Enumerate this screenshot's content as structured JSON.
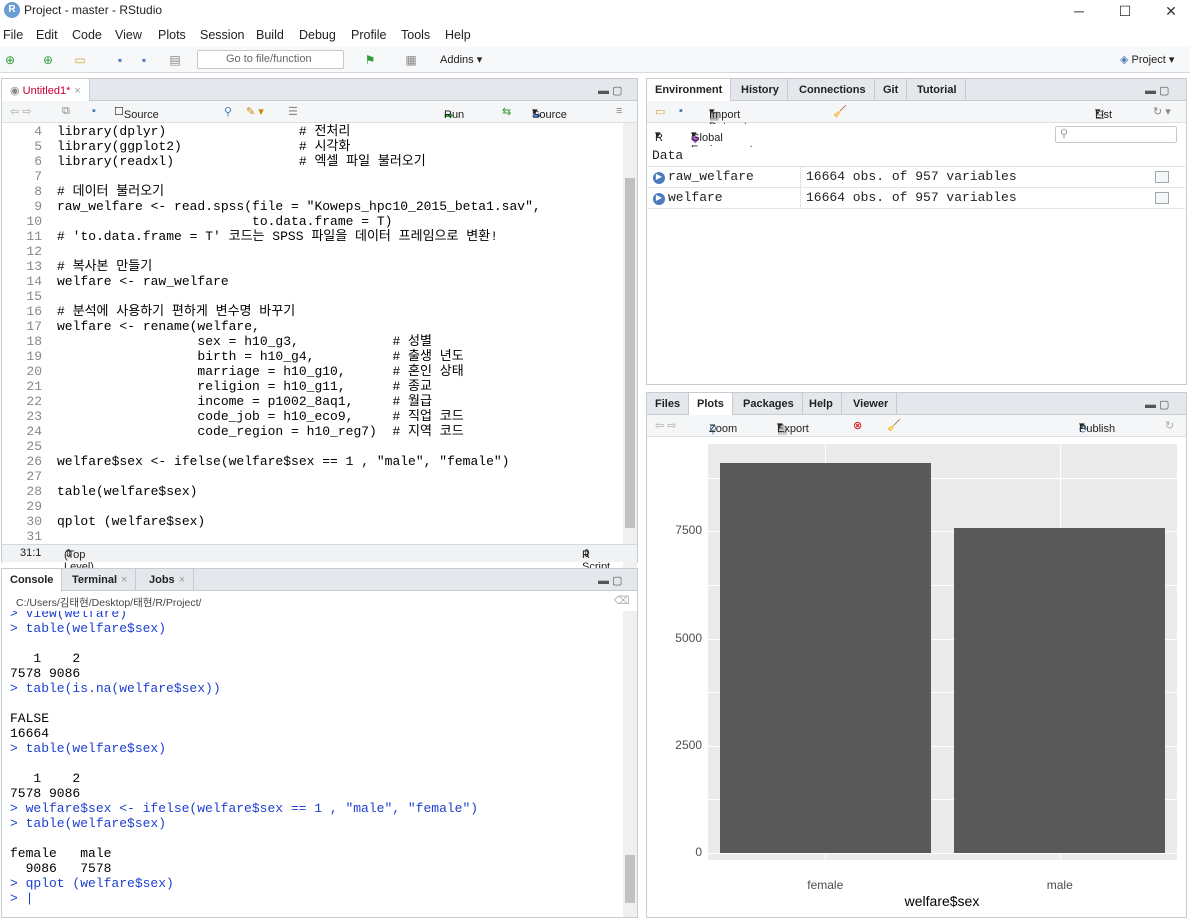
{
  "window": {
    "title": "Project - master - RStudio",
    "icon": "R"
  },
  "menu": [
    "File",
    "Edit",
    "Code",
    "View",
    "Plots",
    "Session",
    "Build",
    "Debug",
    "Profile",
    "Tools",
    "Help"
  ],
  "toolbar": {
    "goto_placeholder": "Go to file/function",
    "addins": "Addins",
    "project": "Project"
  },
  "editor": {
    "tab": "Untitled1*",
    "source_on_save": "Source on Save",
    "run": "Run",
    "source": "Source",
    "lines": [
      {
        "n": "4",
        "t": "library(dplyr)                 # 전처리"
      },
      {
        "n": "5",
        "t": "library(ggplot2)               # 시각화"
      },
      {
        "n": "6",
        "t": "library(readxl)                # 엑셀 파일 불러오기"
      },
      {
        "n": "7",
        "t": ""
      },
      {
        "n": "8",
        "t": "# 데이터 불러오기"
      },
      {
        "n": "9",
        "t": "raw_welfare <- read.spss(file = \"Koweps_hpc10_2015_beta1.sav\","
      },
      {
        "n": "10",
        "t": "                         to.data.frame = T)"
      },
      {
        "n": "11",
        "t": "# 'to.data.frame = T' 코드는 SPSS 파일을 데이터 프레임으로 변환!"
      },
      {
        "n": "12",
        "t": ""
      },
      {
        "n": "13",
        "t": "# 복사본 만들기"
      },
      {
        "n": "14",
        "t": "welfare <- raw_welfare"
      },
      {
        "n": "15",
        "t": ""
      },
      {
        "n": "16",
        "t": "# 분석에 사용하기 편하게 변수명 바꾸기"
      },
      {
        "n": "17",
        "t": "welfare <- rename(welfare,"
      },
      {
        "n": "18",
        "t": "                  sex = h10_g3,            # 성별"
      },
      {
        "n": "19",
        "t": "                  birth = h10_g4,          # 출생 년도"
      },
      {
        "n": "20",
        "t": "                  marriage = h10_g10,      # 혼인 상태"
      },
      {
        "n": "21",
        "t": "                  religion = h10_g11,      # 종교"
      },
      {
        "n": "22",
        "t": "                  income = p1002_8aq1,     # 월급"
      },
      {
        "n": "23",
        "t": "                  code_job = h10_eco9,     # 직업 코드"
      },
      {
        "n": "24",
        "t": "                  code_region = h10_reg7)  # 지역 코드"
      },
      {
        "n": "25",
        "t": ""
      },
      {
        "n": "26",
        "t": "welfare$sex <- ifelse(welfare$sex == 1 , \"male\", \"female\")"
      },
      {
        "n": "27",
        "t": ""
      },
      {
        "n": "28",
        "t": "table(welfare$sex)"
      },
      {
        "n": "29",
        "t": ""
      },
      {
        "n": "30",
        "t": "qplot (welfare$sex)"
      },
      {
        "n": "31",
        "t": ""
      }
    ],
    "status_pos": "31:1",
    "status_level": "(Top Level)",
    "status_type": "R Script"
  },
  "console": {
    "tabs": [
      "Console",
      "Terminal",
      "Jobs"
    ],
    "path": "C:/Users/김태현/Desktop/태현/R/Project/",
    "lines": [
      {
        "c": "in",
        "t": "> View(welfare)"
      },
      {
        "c": "in",
        "t": "> table(welfare$sex)"
      },
      {
        "c": "out",
        "t": ""
      },
      {
        "c": "out",
        "t": "   1    2 "
      },
      {
        "c": "out",
        "t": "7578 9086 "
      },
      {
        "c": "in",
        "t": "> table(is.na(welfare$sex))"
      },
      {
        "c": "out",
        "t": ""
      },
      {
        "c": "out",
        "t": "FALSE "
      },
      {
        "c": "out",
        "t": "16664 "
      },
      {
        "c": "in",
        "t": "> table(welfare$sex)"
      },
      {
        "c": "out",
        "t": ""
      },
      {
        "c": "out",
        "t": "   1    2 "
      },
      {
        "c": "out",
        "t": "7578 9086 "
      },
      {
        "c": "in",
        "t": "> welfare$sex <- ifelse(welfare$sex == 1 , \"male\", \"female\")"
      },
      {
        "c": "in",
        "t": "> table(welfare$sex)"
      },
      {
        "c": "out",
        "t": ""
      },
      {
        "c": "out",
        "t": "female   male "
      },
      {
        "c": "out",
        "t": "  9086   7578 "
      },
      {
        "c": "in",
        "t": "> qplot (welfare$sex)"
      },
      {
        "c": "in",
        "t": "> |"
      }
    ]
  },
  "environment": {
    "tabs": [
      "Environment",
      "History",
      "Connections",
      "Git",
      "Tutorial"
    ],
    "import_dataset": "Import Dataset",
    "list": "List",
    "r_label": "R",
    "global_env": "Global Environment",
    "section": "Data",
    "rows": [
      {
        "name": "raw_welfare",
        "value": "16664 obs. of 957 variables"
      },
      {
        "name": "welfare",
        "value": "16664 obs. of 957 variables"
      }
    ]
  },
  "plots": {
    "tabs": [
      "Files",
      "Plots",
      "Packages",
      "Help",
      "Viewer"
    ],
    "zoom": "Zoom",
    "export": "Export",
    "publish": "Publish"
  },
  "chart_data": {
    "type": "bar",
    "categories": [
      "female",
      "male"
    ],
    "values": [
      9086,
      7578
    ],
    "xlabel": "welfare$sex",
    "ylabel": "",
    "yticks": [
      "0",
      "2500",
      "5000",
      "7500"
    ],
    "ylim": [
      0,
      9540
    ],
    "grid": true
  }
}
